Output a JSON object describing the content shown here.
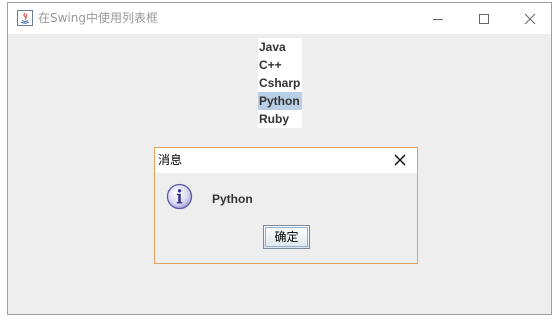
{
  "window": {
    "title": "在Swing中使用列表框"
  },
  "list": {
    "items": [
      {
        "label": "Java",
        "selected": false
      },
      {
        "label": "C++",
        "selected": false
      },
      {
        "label": "Csharp",
        "selected": false
      },
      {
        "label": "Python",
        "selected": true
      },
      {
        "label": "Ruby",
        "selected": false
      }
    ]
  },
  "dialog": {
    "title": "消息",
    "message": "Python",
    "ok_label": "确定",
    "icon": "info-icon"
  },
  "colors": {
    "selection": "#b8cfe5",
    "dialog_border": "#e0a15c",
    "window_bg": "#eeeeee"
  }
}
